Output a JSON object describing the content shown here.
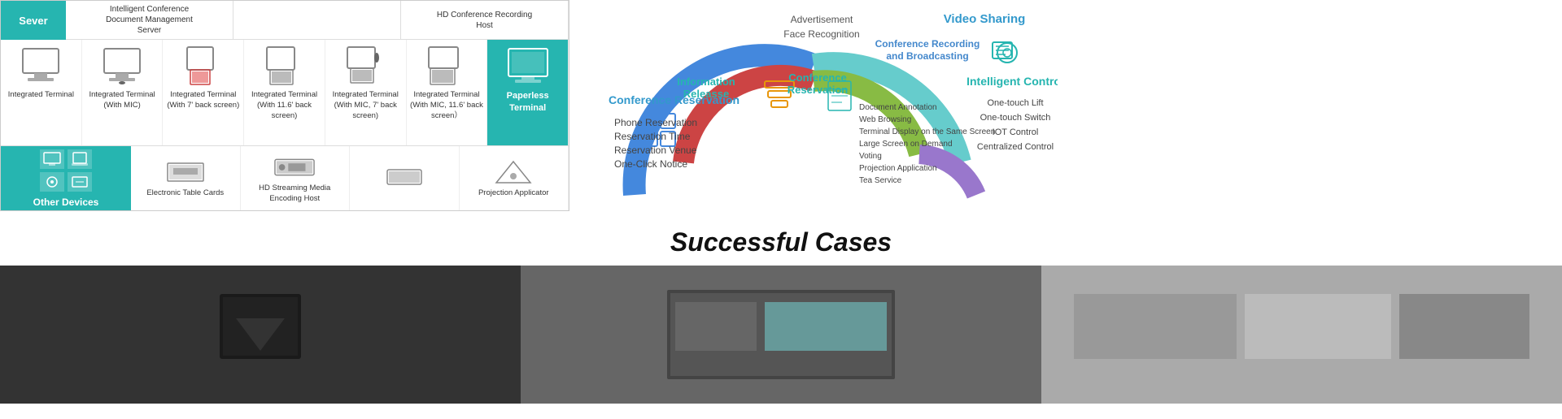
{
  "sever": {
    "label": "Sever"
  },
  "server_names": [
    "Intelligent Conference Document Management Server",
    "",
    "HD Conference Recording Host"
  ],
  "devices": [
    {
      "label": "Integrated Terminal",
      "highlighted": false
    },
    {
      "label": "Integrated Terminal (With MIC)",
      "highlighted": false
    },
    {
      "label": "Integrated Terminal (With 7' back screen)",
      "highlighted": false
    },
    {
      "label": "Integrated Terminal (With 11.6' back screen)",
      "highlighted": false
    },
    {
      "label": "Integrated Terminal (With MIC, 7' back screen)",
      "highlighted": false
    },
    {
      "label": "Integrated Terminal (With MIC, 11.6' back screen）",
      "highlighted": false
    },
    {
      "label": "Paperless Terminal",
      "highlighted": true
    }
  ],
  "other_devices": {
    "label": "Other Devices"
  },
  "bottom_devices": [
    {
      "label": "Electronic Table Cards"
    },
    {
      "label": "HD Streaming Media Encoding Host"
    },
    {
      "label": ""
    },
    {
      "label": "Projection Applicator"
    }
  ],
  "diagram": {
    "conference_reservation": {
      "title": "Conference Reservation",
      "items": [
        "Phone Reservation",
        "Reservation Time",
        "Reservation Venue",
        "One-Click Notice"
      ]
    },
    "information_release": {
      "label": "Information Releasse"
    },
    "advertisement": {
      "label": "Advertisement"
    },
    "face_recognition": {
      "label": "Face Recognition"
    },
    "conference_reservation_inner": {
      "title": "Conference Reservation",
      "items": [
        "Document Annotation",
        "Web Browsing",
        "Terminal Display on the Same Screen",
        "Large Screen on Demand",
        "Voting",
        "Projection Application",
        "Tea Service"
      ]
    },
    "conf_recording_broadcasting": {
      "title": "Conference Recording and Broadcasting",
      "items": []
    },
    "video_sharing": {
      "title": "Video Sharing"
    },
    "intelligent_control": {
      "title": "Intelligent Control",
      "items": [
        "One-touch Lift",
        "One-touch Switch",
        "IOT Control",
        "Centralized Control"
      ]
    }
  },
  "successful_cases": {
    "title": "Successful Cases"
  }
}
